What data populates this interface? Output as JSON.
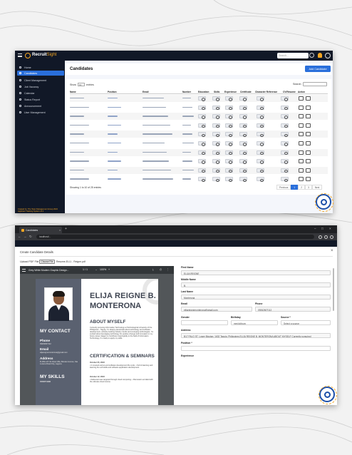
{
  "window1": {
    "app_logo": "Recruit",
    "app_logo_suffix": "Sight",
    "search_placeholder": "Search...",
    "sidebar": {
      "items": [
        {
          "label": "Home",
          "icon": "home-icon"
        },
        {
          "label": "Candidates",
          "icon": "people-icon",
          "active": true
        },
        {
          "label": "Client Management",
          "icon": "briefcase-icon"
        },
        {
          "label": "Job Vacancy",
          "icon": "gear-icon"
        },
        {
          "label": "Calendar",
          "icon": "calendar-icon"
        },
        {
          "label": "Status Report",
          "icon": "report-icon"
        },
        {
          "label": "Announcement",
          "icon": "megaphone-icon"
        },
        {
          "label": "User Management",
          "icon": "user-icon"
        }
      ],
      "footer": "Created by: The Team Management Group 2024 Applicant Tracking System v2.1"
    },
    "page_title": "Candidates",
    "add_button": "Add Candidate",
    "show_label": "Show",
    "show_value": "10",
    "entries_label": "entries",
    "search_label": "Search:",
    "columns": [
      "Name",
      "Position",
      "Email",
      "Number",
      "Education",
      "Skills",
      "Experience",
      "Certificate",
      "Character Reference",
      "CV/Resume",
      "Action"
    ],
    "row_count": 10,
    "showing_text": "Showing 1 to 10 of 25 entries",
    "pagination": [
      "Previous",
      "1",
      "2",
      "3",
      "Next"
    ]
  },
  "window2": {
    "tab_title": "Candidates",
    "url": "localhost/...",
    "modal_title": "Create Candidate Details",
    "upload_label": "Upload PDF File",
    "choose_button": "Choose File",
    "file_name": "Resume-ELIJ... Reigne.pdf",
    "pdf_viewer": {
      "doc_title": "Grey White Modern Graphic Design...",
      "page_info": "1 / 1",
      "zoom": "100%"
    },
    "resume": {
      "name_line1": "ELIJA REIGNE B.",
      "name_line2": "MONTERONA",
      "about_heading": "ABOUT MYSELF",
      "about_text": "Currently pursuing Information Technology at Technological University of the Philippines - Taguig. I'm deeply passionate about technology and software development, actively tracking industry trends and emerging technologies. I'm excited about leveraging technology for positive change and innovation in my future career. Eager to contribute meaningfully to the field of Information Technology, I'm ready to apply my skills.",
      "cert_heading": "CERTIFICATION & SEMINARS",
      "cert1_date": "October 05, 2023",
      "cert1_text": "• It covered end-to-end software development life cycle. • Full of learning and learning the soft skills and software application development.",
      "cert2_date": "October 12, 2023",
      "cert2_text": "• Delivered user-targeted through cloud computing. • Discussion enrolled with the ultimate cloud course.",
      "contact_heading": "MY CONTACT",
      "phone_label": "Phone",
      "phone_value": "09262607112",
      "email_label": "Email",
      "email_value": "elijareignemonterona@gmail.com",
      "address_label": "Address",
      "address_value": "B-159 LOT 02 Rosa Villa, Bicutan Homes, Sta Lucena Road City, Laguna",
      "skills_heading": "MY SKILLS",
      "skills_sub": "FRONT END"
    },
    "form": {
      "first_name_label": "First Name",
      "first_name_value": "ELIJA REIGNE",
      "middle_name_label": "Middle Name",
      "middle_name_value": "B.",
      "last_name_label": "Last Name",
      "last_name_value": "Monterona",
      "email_label": "Email",
      "email_value": "elijareignemonterona@gmail.com",
      "phone_label": "Phone",
      "phone_value": "09262607112",
      "gender_label": "Gender",
      "gender_value": "",
      "birthday_label": "Birthday",
      "birthday_value": "mm/dd/yyyy",
      "source_label": "Source *",
      "source_value": "Select a source",
      "address_label": "Address",
      "address_value": "B17 PALO ST. Lower Bicutan, 1632 Taguig, Philippines ELIJA REIGNE B. MONTERONA ABOUT MYSELF Currently pursuing I",
      "position_label": "Position *",
      "experience_label": "Experience"
    }
  },
  "colors": {
    "sidebar_bg": "#111827",
    "accent_blue": "#2a6fdb",
    "accent_orange": "#f5a623",
    "resume_sidebar": "#5a6170"
  }
}
